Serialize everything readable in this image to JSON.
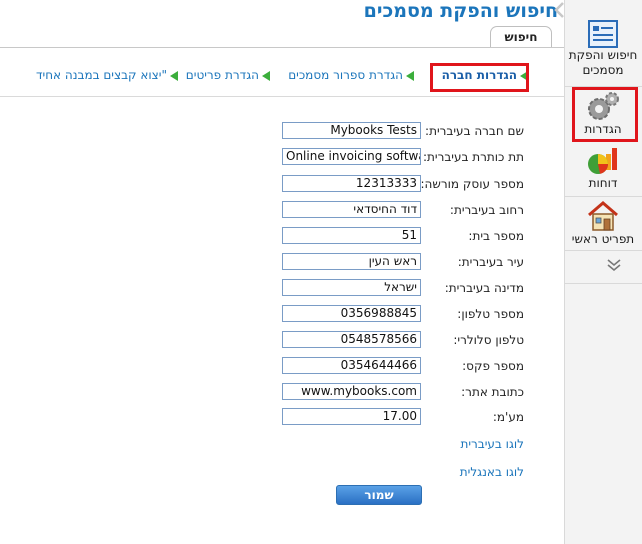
{
  "header": {
    "title": "חיפוש והפקת מסמכים",
    "tab_label": "חיפוש"
  },
  "subnav": [
    {
      "label": "הגדרות חברה",
      "active": true
    },
    {
      "label": "הגדרת ספרור מסמכים",
      "active": false
    },
    {
      "label": "הגדרת פריטים",
      "active": false
    },
    {
      "label": "\"יצוא קבצים במבנה אחיד",
      "active": false
    }
  ],
  "sidebar": {
    "items": [
      {
        "label_line1": "חיפוש והפקת",
        "label_line2": "מסמכים",
        "icon": "documents-icon"
      },
      {
        "label": "הגדרות",
        "icon": "gears-icon"
      },
      {
        "label": "דוחות",
        "icon": "pie-chart-icon"
      },
      {
        "label": "תפריט ראשי",
        "icon": "home-icon"
      }
    ],
    "more_icon": "double-chevron-down-icon"
  },
  "form": {
    "fields": [
      {
        "label": "שם חברה בעיברית:",
        "value": "Mybooks Tests"
      },
      {
        "label": "תת כותרת בעיברית:",
        "value": "Online invoicing software"
      },
      {
        "label": "מספר עוסק מורשה:",
        "value": "12313333"
      },
      {
        "label": "רחוב בעיברית:",
        "value": "דוד החיסדאי"
      },
      {
        "label": "מספר בית:",
        "value": "51"
      },
      {
        "label": "עיר בעיברית:",
        "value": "ראש העין"
      },
      {
        "label": "מדינה בעיברית:",
        "value": "ישראל"
      },
      {
        "label": "מספר טלפון:",
        "value": "0356988845"
      },
      {
        "label": "טלפון סלולרי:",
        "value": "0548578566"
      },
      {
        "label": "מספר פקס:",
        "value": "0354644466"
      },
      {
        "label": "כתובת אתר:",
        "value": "www.mybooks.com"
      },
      {
        "label": "מע'מ:",
        "value": "17.00"
      }
    ],
    "logo_hebrew": "לוגו בעיברית",
    "logo_english": "לוגו באנגלית",
    "save_label": "שמור"
  }
}
